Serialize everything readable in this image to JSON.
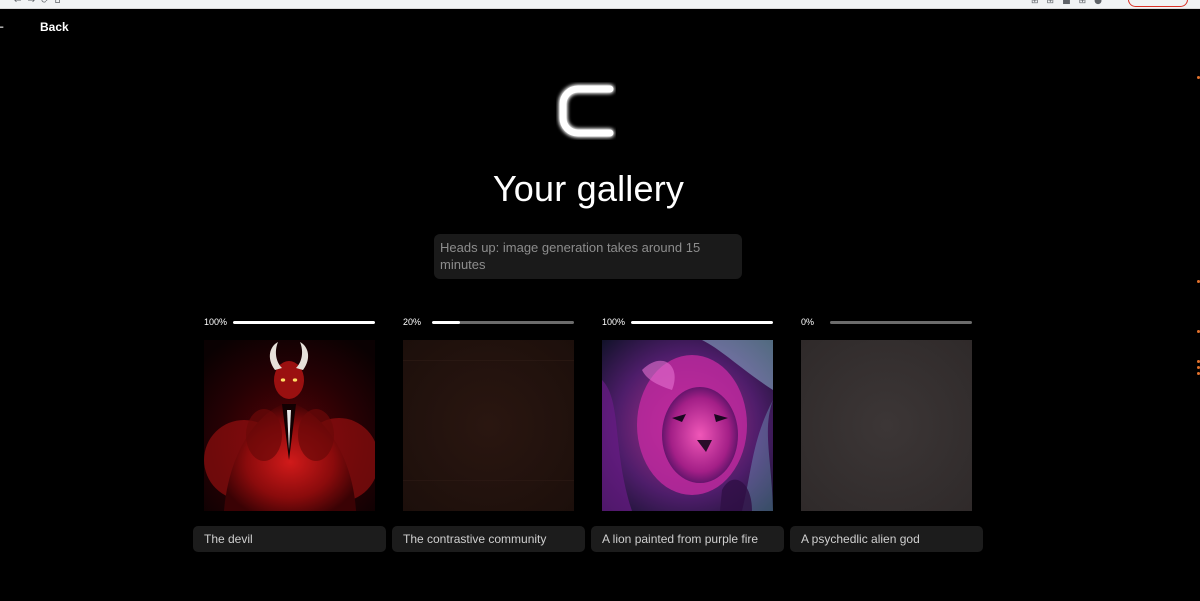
{
  "nav": {
    "back_label": "Back",
    "back_icon": "arrow-left-icon"
  },
  "header": {
    "logo_icon": "c-logo-icon",
    "title": "Your gallery"
  },
  "notice": {
    "text": "Heads up: image generation takes around 15 minutes"
  },
  "gallery": {
    "items": [
      {
        "progress_label": "100%",
        "progress": 1.0,
        "caption": "The devil",
        "image": "devil-image"
      },
      {
        "progress_label": "20%",
        "progress": 0.2,
        "caption": "The contrastive community",
        "image": "placeholder-dark-brown-image"
      },
      {
        "progress_label": "100%",
        "progress": 1.0,
        "caption": "A lion painted from purple fire",
        "image": "purple-lion-image"
      },
      {
        "progress_label": "0%",
        "progress": 0.0,
        "caption": "A psychedlic alien god",
        "image": "placeholder-gray-image"
      }
    ]
  },
  "colors": {
    "background": "#000000",
    "panel": "#1a1a1a",
    "progress_track": "#6c6c6c",
    "progress_fill": "#ffffff",
    "muted_text": "#8d8d8d"
  }
}
